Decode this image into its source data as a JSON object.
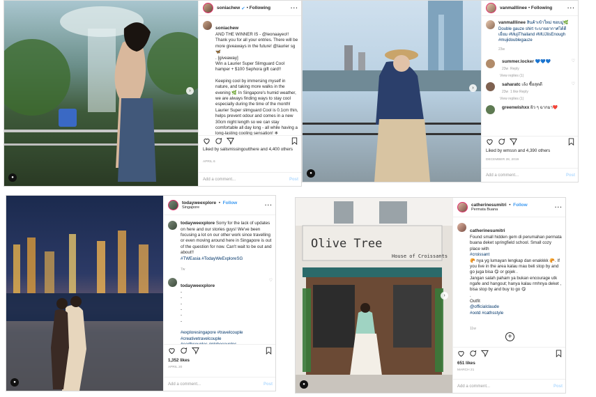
{
  "posts": {
    "p1": {
      "user": "soniachew",
      "follow": "Following",
      "caption_user": "soniachew",
      "caption": "AND THE WINNER IS - @leonaayeo!! Thank you for all your entries. There will be more giveaways in the future! @laurier sg 🦋\n. [giveaway]\nWin a Laurier Super Slimguard Cool hamper + $100 Sephora gift card!!\n\nKeeping cool by immersing myself in nature, and taking more walks in the evening 🌿 In Singapore's humid weather, we are always finding ways to stay cool especially during the time of the month! Laurier Super slimguard Cool is 0.1cm thin, helps prevent odour and comes in a new 30cm night length so we can stay comfortable all day long - all while having a long-lasting cooling sensation! ❄",
      "likes": "Liked by salismissingoutthere and 4,400 others",
      "date": "APRIL 6",
      "add_comment": "Add a comment...",
      "post_btn": "Post"
    },
    "p2": {
      "user": "vanmalllinee",
      "follow": "Following",
      "caption_user": "vanmalllinee",
      "caption": "สินค้าเข้าใหม่ ชอบมู่🌿Double gauze shirt ระบายอากาศได้ดีเยี่ยม #MujiThailand #MUJIisEnough #mujidoublegauze",
      "caption_time": "23w",
      "comments": [
        {
          "user": "summer.locker",
          "text": "💙💙💙",
          "time": "23w",
          "reply": "Reply",
          "view": "View replies (1)"
        },
        {
          "user": "saharatc",
          "text": "เล้ง ซื้อสุดดี",
          "time": "23w",
          "reply": "1 like  Reply",
          "view": "View replies (1)"
        },
        {
          "user": "greenwishxx",
          "text": "ผิว ๆ ฉากมา❤️",
          "time": "",
          "reply": "",
          "view": ""
        }
      ],
      "likes": "Liked by wmssn and 4,390 others",
      "date": "DECEMBER 28, 2019",
      "add_comment": "Add a comment...",
      "post_btn": "Post"
    },
    "p3": {
      "user": "todayweexplore",
      "follow": "Follow",
      "location": "Singapore",
      "caption_user": "todayweexplore",
      "caption": "Sorry for the lack of updates on here and our stories guys! We've been focusing a lot on our other work since travelling or even moving around here in Singapore is out of the question for now. Can't wait to be out and about!!",
      "tags1": "#TWEasia #TodayWeExploreSG",
      "caption_time": "7w",
      "comment_user": "todayweexplore",
      "comment_dash": "-\n-\n-\n-\n-",
      "tags2": "#exploresingapore #travelcouple\n#creativetravelcouple\n#earthcouples #globecouples",
      "likes": "1,352 likes",
      "date": "APRIL 20",
      "add_comment": "Add a comment...",
      "post_btn": "Post"
    },
    "p4": {
      "user": "catherinesumitri",
      "follow": "Follow",
      "location": "Permata Buana",
      "caption_user": "catherinesumitri",
      "caption": "Found small hidden gem di perumahan permata buana deket springfield school. Small cozy place with",
      "mention1": "#croissant",
      "caption2": "🥐 nya yg lumayan lengkap dan enakkkk 🥐. If you live in the area kalau mau beli stop by and go juga bisa 😋 or gojek .\nJangan salah paham ya bukan encourage utk ngafe and hangout; hanya kalau rmhnya deket , bisa stop by and buy to go 😋\n.\nOutfit",
      "mention2": "@officialclaude",
      "tags": "#ootd #cathsstyle",
      "caption_time": "11w",
      "likes": "651 likes",
      "date": "MARCH 21",
      "add_comment": "Add a comment...",
      "post_btn": "Post",
      "sign_title": "Olive Tree",
      "sign_sub": "House of Croissants"
    }
  },
  "colors": {
    "link": "#3897f0",
    "tag": "#003569",
    "border": "#dbdbdb"
  }
}
